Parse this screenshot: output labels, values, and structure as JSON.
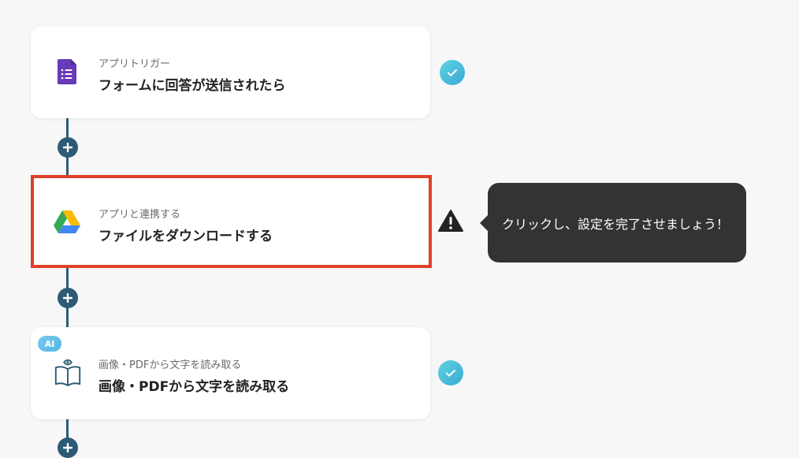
{
  "steps": [
    {
      "sub": "アプリトリガー",
      "title": "フォームに回答が送信されたら",
      "icon": "google-forms-icon",
      "status": "complete"
    },
    {
      "sub": "アプリと連携する",
      "title": "ファイルをダウンロードする",
      "icon": "google-drive-icon",
      "status": "warning"
    },
    {
      "sub": "画像・PDFから文字を読み取る",
      "title": "画像・PDFから文字を読み取る",
      "icon": "ocr-book-eye-icon",
      "status": "complete",
      "badge": "AI"
    }
  ],
  "tooltip": {
    "text": "クリックし、設定を完了させましょう！"
  },
  "colors": {
    "connector": "#2d5b75",
    "selected_border": "#e0402a",
    "check": "#4ec0dd",
    "tooltip_bg": "#333333"
  }
}
